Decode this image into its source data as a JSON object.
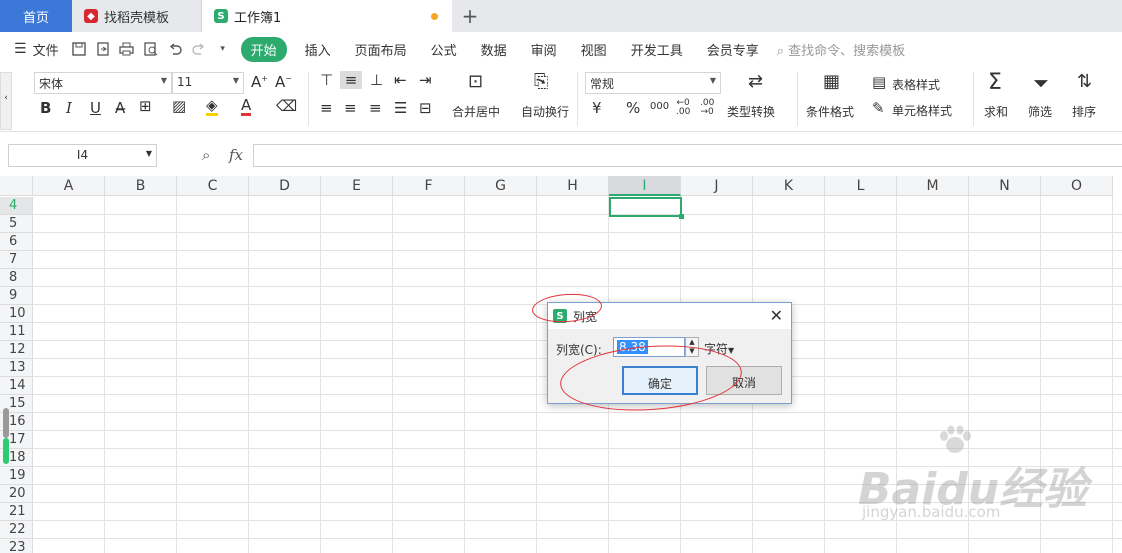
{
  "tabs": [
    {
      "label": "首页",
      "active": false
    },
    {
      "label": "找稻壳模板",
      "active": false
    },
    {
      "label": "工作簿1",
      "active": true,
      "unsaved": true
    }
  ],
  "new_tab_icon": "+",
  "menu": {
    "file_label": "文件",
    "items": [
      "开始",
      "插入",
      "页面布局",
      "公式",
      "数据",
      "审阅",
      "视图",
      "开发工具",
      "会员专享"
    ],
    "active": "开始",
    "search_placeholder": "查找命令、搜索模板"
  },
  "ribbon": {
    "font_name": "宋体",
    "font_size": "11",
    "number_format": "常规",
    "labels": {
      "merge_center": "合并居中",
      "wrap_text": "自动换行",
      "type_convert": "类型转换",
      "cond_format": "条件格式",
      "table_style": "表格样式",
      "cell_style": "单元格样式",
      "sum": "求和",
      "filter": "筛选",
      "sort": "排序"
    }
  },
  "formula_bar": {
    "cell_ref": "I4",
    "fx": "fx",
    "value": ""
  },
  "grid": {
    "columns": [
      "A",
      "B",
      "C",
      "D",
      "E",
      "F",
      "G",
      "H",
      "I",
      "J",
      "K",
      "L",
      "M",
      "N",
      "O"
    ],
    "selected_column": "I",
    "rows": [
      "4",
      "5",
      "6",
      "7",
      "8",
      "9",
      "10",
      "11",
      "12",
      "13",
      "14",
      "15",
      "16",
      "17",
      "18",
      "19",
      "20",
      "21",
      "22",
      "23"
    ],
    "selected_row": "4"
  },
  "dialog": {
    "title": "列宽",
    "field_label": "列宽(C):",
    "value": "8.38",
    "unit": "字符",
    "ok_label": "确定",
    "cancel_label": "取消"
  },
  "watermark": {
    "brand": "Baidu经验",
    "url": "jingyan.baidu.com"
  },
  "colors": {
    "accent_green": "#2daa6d",
    "home_tab_blue": "#3c78d8",
    "annotation_red": "#e0333a"
  }
}
